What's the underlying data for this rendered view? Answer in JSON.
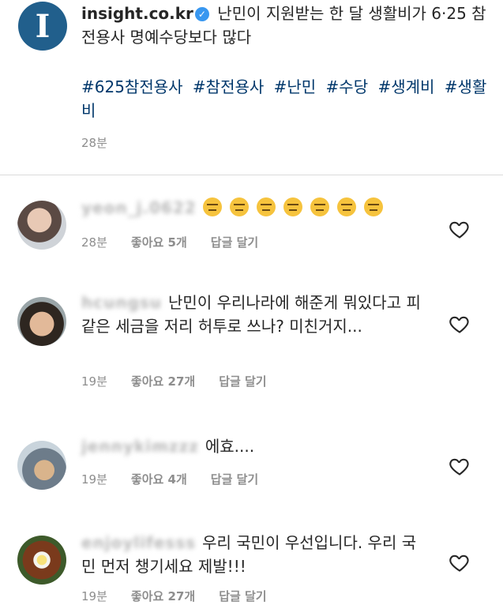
{
  "post": {
    "avatar_letter": "I",
    "username": "insight.co.kr",
    "verified_glyph": "✓",
    "caption": "난민이 지원받는 한 달 생활비가 6·25 참전용사 명예수당보다 많다",
    "hashtags": [
      "#625참전용사",
      "#참전용사",
      "#난민",
      "#수당",
      "#생계비",
      "#생활비"
    ],
    "time": "28분"
  },
  "comments": [
    {
      "username": "yeon_j.0622",
      "text": "",
      "emoji": "expressionless-face-emoji",
      "emoji_count": 7,
      "time": "28분",
      "likes": "좋아요 5개",
      "reply": "답글 달기"
    },
    {
      "username": "hcungsu",
      "text": "난민이 우리나라에 해준게 뭐있다고 피같은 세금을 저리 허투로 쓰나? 미친거지...",
      "time": "19분",
      "likes": "좋아요 27개",
      "reply": "답글 달기"
    },
    {
      "username": "jennykimzzz",
      "text": "에효....",
      "time": "19분",
      "likes": "좋아요 4개",
      "reply": "답글 달기"
    },
    {
      "username": "enjoylifesss",
      "text": "우리 국민이 우선입니다. 우리 국민 먼저 챙기세요 제발!!!",
      "time": "19분",
      "likes": "좋아요 27개",
      "reply": "답글 달기"
    }
  ],
  "colors": {
    "brand": "#215f8c",
    "hashtag": "#00376b",
    "meta": "#8e8e8e",
    "verified": "#3897f0"
  }
}
